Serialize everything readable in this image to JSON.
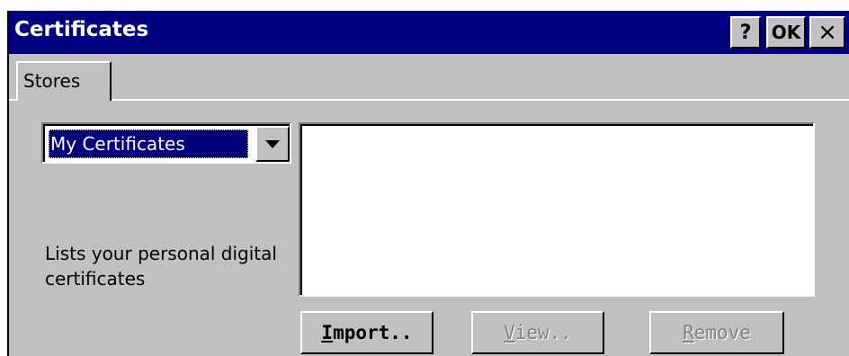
{
  "window": {
    "title": "Certificates",
    "help_label": "?",
    "ok_label": "OK",
    "close_label": "×"
  },
  "tabs": [
    {
      "label": "Stores",
      "selected": true
    }
  ],
  "store_select": {
    "value": "My Certificates"
  },
  "description": "Lists your personal digital certificates",
  "certificate_list": [],
  "buttons": {
    "import": {
      "label": "Import..",
      "enabled": true
    },
    "view": {
      "label": "View..",
      "enabled": false
    },
    "remove": {
      "label": "Remove",
      "enabled": false
    }
  },
  "colors": {
    "titlebar": "#000080",
    "face": "#c0c0c0",
    "disabled_text": "#808080"
  }
}
